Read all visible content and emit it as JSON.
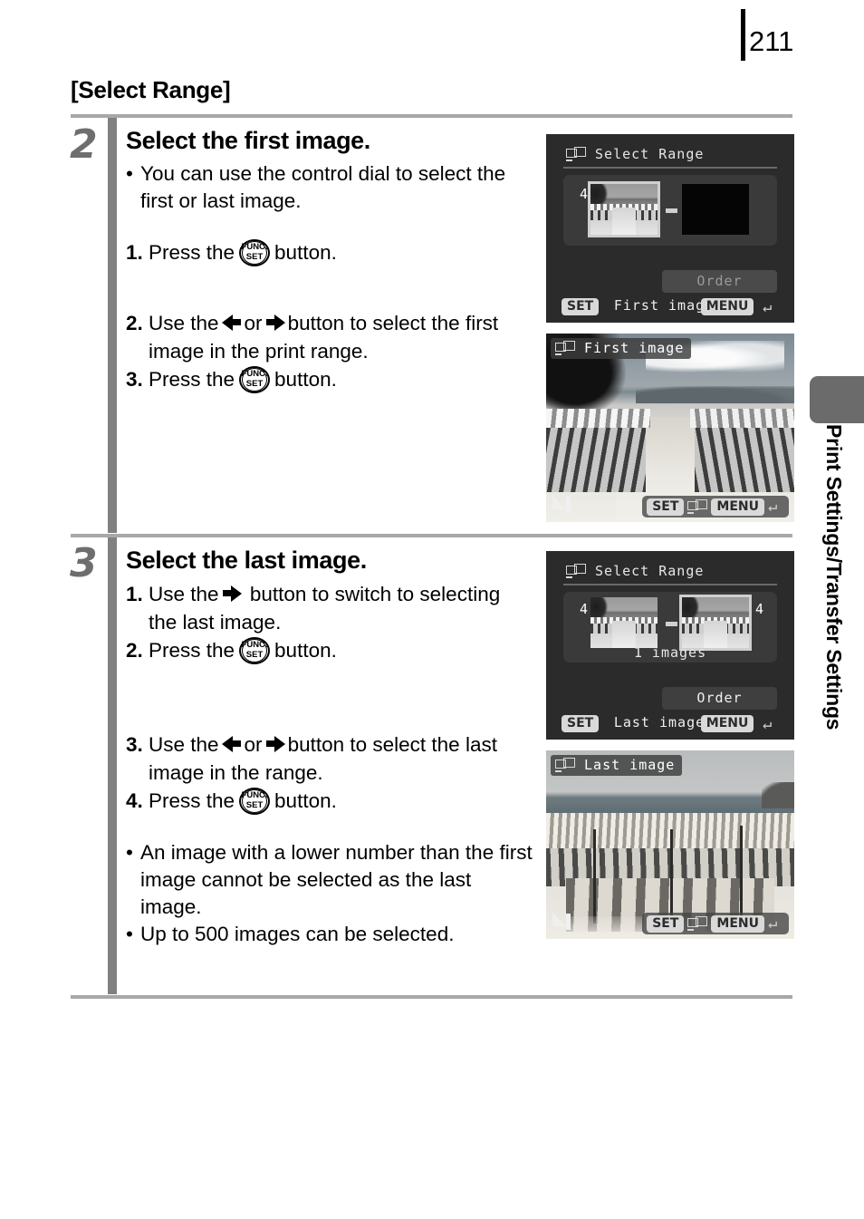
{
  "page": {
    "number": "211"
  },
  "section": {
    "title": "[Select Range]"
  },
  "sidebar": {
    "label": "Print Settings/Transfer Settings"
  },
  "steps": [
    {
      "number": "2",
      "heading": "Select the first image.",
      "lines": [
        {
          "mark": "•",
          "text": "You can use the control dial to select the first or last image."
        },
        {
          "mark": "1.",
          "pre": "Press the",
          "icon": "func-set",
          "post": "button."
        },
        {
          "mark": "2.",
          "pre": "Use the",
          "icon": "left-right-arrows",
          "post": "button to select the first image in the print range."
        },
        {
          "mark": "3.",
          "pre": "Press the",
          "icon": "func-set",
          "post": "button."
        }
      ]
    },
    {
      "number": "3",
      "heading": "Select the last image.",
      "lines": [
        {
          "mark": "1.",
          "pre": "Use the",
          "icon": "right-arrow",
          "post": "button to switch to selecting the last image."
        },
        {
          "mark": "2.",
          "pre": "Press the",
          "icon": "func-set",
          "post": "button."
        },
        {
          "mark": "3.",
          "pre": "Use the",
          "icon": "left-right-arrows",
          "post": "button to select the last image in the range."
        },
        {
          "mark": "4.",
          "pre": "Press the",
          "icon": "func-set",
          "post": "button."
        },
        {
          "mark": "•",
          "text": "An image with a lower number than the first image cannot be selected as the last image."
        },
        {
          "mark": "•",
          "text": "Up to 500 images can be selected."
        }
      ]
    }
  ],
  "screens": {
    "select_range_first": {
      "title": "Select Range",
      "icon": "dpof-print-icon",
      "first_thumb_number": "4",
      "second_thumb_number": "",
      "order_label": "Order",
      "order_enabled": false,
      "set_key": "SET",
      "set_label": "First image",
      "menu_key": "MENU",
      "return_icon": "return-arrow-icon"
    },
    "first_image": {
      "overlay_title": "First image",
      "icon": "dpof-print-icon",
      "quality_icon": "large-fine-quality-icon",
      "set_key": "SET",
      "menu_key": "MENU",
      "return_icon": "return-arrow-icon"
    },
    "select_range_last": {
      "title": "Select Range",
      "icon": "dpof-print-icon",
      "first_thumb_number": "4",
      "second_thumb_number": "4",
      "image_count": "1 images",
      "order_label": "Order",
      "order_enabled": true,
      "set_key": "SET",
      "set_label": "Last image",
      "menu_key": "MENU",
      "return_icon": "return-arrow-icon"
    },
    "last_image": {
      "overlay_title": "Last image",
      "icon": "dpof-print-icon",
      "quality_icon": "large-fine-quality-icon",
      "set_key": "SET",
      "menu_key": "MENU",
      "return_icon": "return-arrow-icon"
    }
  },
  "colors": {
    "rule": "#a8a8a8",
    "step_bar": "#808080",
    "step_number": "#6e6e6e",
    "tab": "#6b6b6b",
    "screen_bg": "#2b2b2b"
  }
}
